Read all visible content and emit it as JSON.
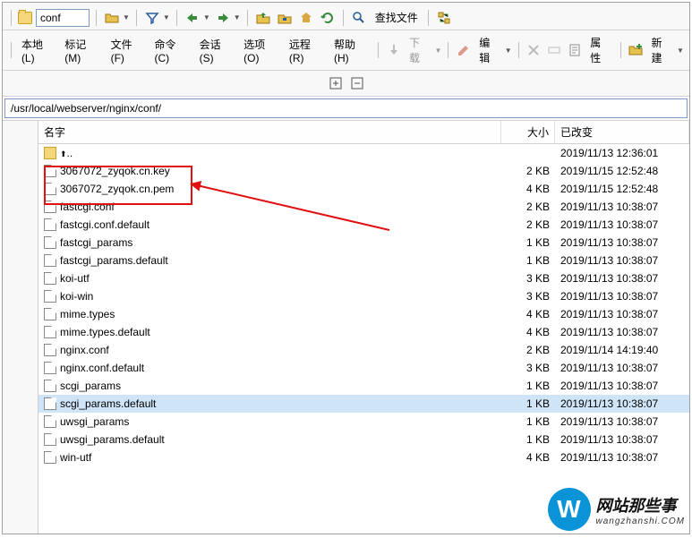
{
  "toolbar": {
    "path_value": "conf",
    "find_file": "查找文件"
  },
  "menu": {
    "local": "本地(L)",
    "mark": "标记(M)",
    "file": "文件(F)",
    "command": "命令(C)",
    "session": "会话(S)",
    "options": "选项(O)",
    "remote": "远程(R)",
    "help": "帮助(H)",
    "download": "下载",
    "edit": "编辑",
    "properties": "属性",
    "new": "新建"
  },
  "address": "/usr/local/webserver/nginx/conf/",
  "columns": {
    "name": "名字",
    "size": "大小",
    "changed": "已改变"
  },
  "files": [
    {
      "name": "..",
      "size": "",
      "date": "2019/11/13 12:36:01",
      "type": "up"
    },
    {
      "name": "3067072_zyqok.cn.key",
      "size": "2 KB",
      "date": "2019/11/15 12:52:48",
      "type": "file"
    },
    {
      "name": "3067072_zyqok.cn.pem",
      "size": "4 KB",
      "date": "2019/11/15 12:52:48",
      "type": "file"
    },
    {
      "name": "fastcgi.conf",
      "size": "2 KB",
      "date": "2019/11/13 10:38:07",
      "type": "file"
    },
    {
      "name": "fastcgi.conf.default",
      "size": "2 KB",
      "date": "2019/11/13 10:38:07",
      "type": "file"
    },
    {
      "name": "fastcgi_params",
      "size": "1 KB",
      "date": "2019/11/13 10:38:07",
      "type": "file"
    },
    {
      "name": "fastcgi_params.default",
      "size": "1 KB",
      "date": "2019/11/13 10:38:07",
      "type": "file"
    },
    {
      "name": "koi-utf",
      "size": "3 KB",
      "date": "2019/11/13 10:38:07",
      "type": "file"
    },
    {
      "name": "koi-win",
      "size": "3 KB",
      "date": "2019/11/13 10:38:07",
      "type": "file"
    },
    {
      "name": "mime.types",
      "size": "4 KB",
      "date": "2019/11/13 10:38:07",
      "type": "file"
    },
    {
      "name": "mime.types.default",
      "size": "4 KB",
      "date": "2019/11/13 10:38:07",
      "type": "file"
    },
    {
      "name": "nginx.conf",
      "size": "2 KB",
      "date": "2019/11/14 14:19:40",
      "type": "file"
    },
    {
      "name": "nginx.conf.default",
      "size": "3 KB",
      "date": "2019/11/13 10:38:07",
      "type": "file"
    },
    {
      "name": "scgi_params",
      "size": "1 KB",
      "date": "2019/11/13 10:38:07",
      "type": "file"
    },
    {
      "name": "scgi_params.default",
      "size": "1 KB",
      "date": "2019/11/13 10:38:07",
      "type": "file",
      "selected": true
    },
    {
      "name": "uwsgi_params",
      "size": "1 KB",
      "date": "2019/11/13 10:38:07",
      "type": "file"
    },
    {
      "name": "uwsgi_params.default",
      "size": "1 KB",
      "date": "2019/11/13 10:38:07",
      "type": "file"
    },
    {
      "name": "win-utf",
      "size": "4 KB",
      "date": "2019/11/13 10:38:07",
      "type": "file"
    }
  ],
  "watermark": {
    "glyph": "W",
    "title": "网站那些事",
    "url": "wangzhanshi.COM"
  }
}
